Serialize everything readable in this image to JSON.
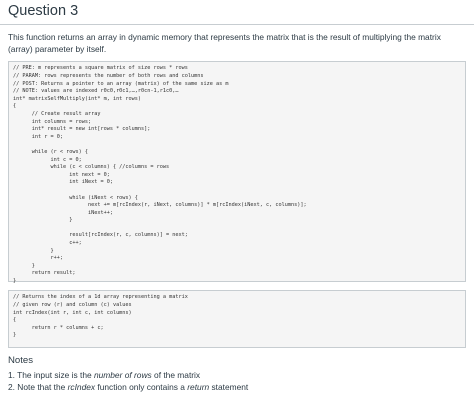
{
  "question": {
    "title": "Question 3",
    "description": "This function returns an array in dynamic memory that represents the matrix that is the result of multiplying the matrix (array) parameter by itself."
  },
  "code_main": "// PRE: m represents a square matrix of size rows * rows\n// PARAM: rows represents the number of both rows and columns\n// POST: Returns a pointer to an array (matrix) of the same size as m\n// NOTE: values are indexed r0c0,r0c1,…,r0cn-1,r1c0,…\nint* matrixSelfMultiply(int* m, int rows)\n{\n      // Create result array\n      int columns = rows;\n      int* result = new int[rows * columns];\n      int r = 0;\n\n      while (r < rows) {\n            int c = 0;\n            while (c < columns) { //columns = rows\n                  int next = 0;\n                  int iNext = 0;\n\n                  while (iNext < rows) {\n                        next += m[rcIndex(r, iNext, columns)] * m[rcIndex(iNext, c, columns)];\n                        iNext++;\n                  }\n\n                  result[rcIndex(r, c, columns)] = next;\n                  c++;\n            }\n            r++;\n      }\n      return result;\n}",
  "code_helper": "// Returns the index of a 1d array representing a matrix\n// given row (r) and column (c) values\nint rcIndex(int r, int c, int columns)\n{\n      return r * columns + c;\n}",
  "notes": {
    "title": "Notes",
    "items": [
      {
        "prefix": "1. The input size is the ",
        "emph": "number of rows",
        "suffix": " of the matrix"
      },
      {
        "prefix": "2. Note that the ",
        "emph": "rcIndex",
        "middle": " function only contains a ",
        "emph2": "return",
        "suffix": " statement"
      }
    ]
  }
}
